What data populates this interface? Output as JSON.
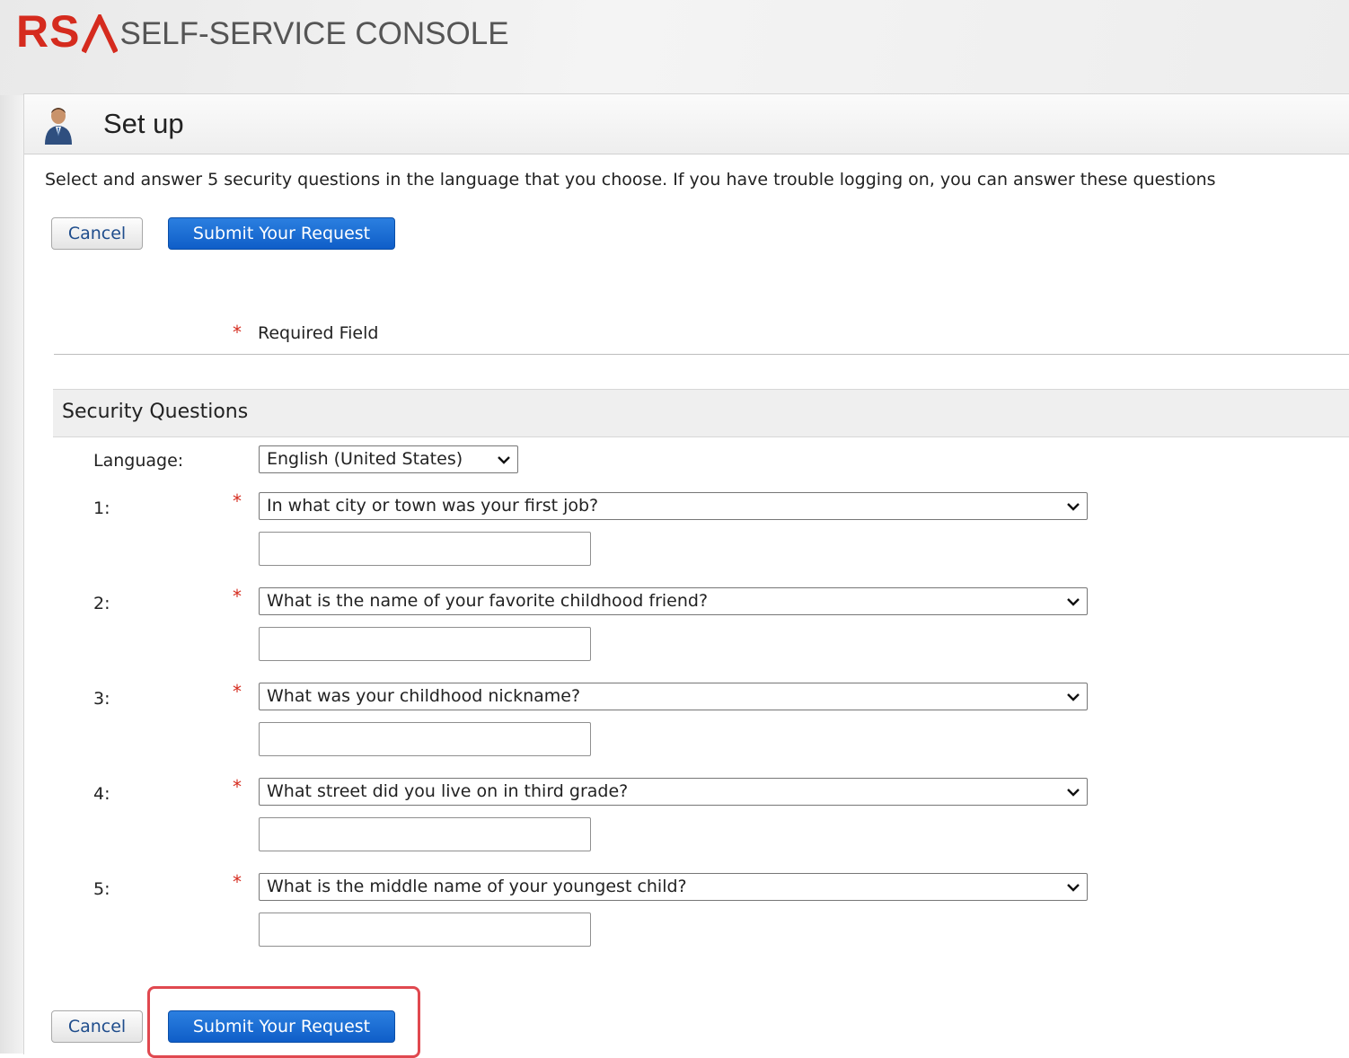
{
  "app": {
    "brand_mark": "RS",
    "brand_title": "SELF-SERVICE CONSOLE"
  },
  "panel": {
    "title": "Set up",
    "intro": "Select and answer 5  security questions in the language that you choose. If you have trouble logging on, you can answer these questions"
  },
  "buttons": {
    "cancel": "Cancel",
    "submit": "Submit Your Request"
  },
  "required": {
    "star": "*",
    "label": "Required Field"
  },
  "section": {
    "title": "Security Questions",
    "language_label": "Language:",
    "language_value": "English (United States)"
  },
  "questions": [
    {
      "number": "1:",
      "question": "In what city or town was your first job?",
      "answer": ""
    },
    {
      "number": "2:",
      "question": "What is the name of your favorite childhood friend?",
      "answer": ""
    },
    {
      "number": "3:",
      "question": "What was your childhood nickname?",
      "answer": ""
    },
    {
      "number": "4:",
      "question": "What street did you live on in third grade?",
      "answer": ""
    },
    {
      "number": "5:",
      "question": "What is the middle name of your youngest child?",
      "answer": ""
    }
  ],
  "colors": {
    "brand_red": "#d52b1e",
    "primary_blue": "#1565d8",
    "highlight_red": "#e0484f"
  }
}
